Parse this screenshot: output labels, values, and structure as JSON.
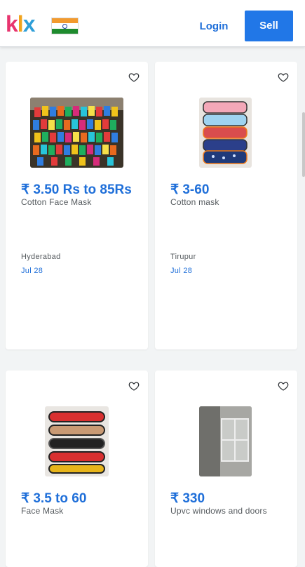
{
  "header": {
    "logo": {
      "k": "k",
      "l": "l",
      "x": "x"
    },
    "login_label": "Login",
    "sell_label": "Sell",
    "flag_icon": "india-flag-icon",
    "accent_color": "#2177e7"
  },
  "listings": [
    {
      "price": "₹ 3.50 Rs to 85Rs",
      "title": "Cotton Face Mask",
      "location": "Hyderabad",
      "date": "Jul 28",
      "image": "colorful-masks-pile-photo"
    },
    {
      "price": "₹ 3-60",
      "title": "Cotton mask",
      "location": "Tirupur",
      "date": "Jul 28",
      "image": "stacked-printed-masks-photo"
    },
    {
      "price": "₹ 3.5 to 60",
      "title": "Face Mask",
      "location": "",
      "date": "",
      "image": "fabric-masks-row-photo"
    },
    {
      "price": "₹ 330",
      "title": "Upvc windows and doors",
      "location": "",
      "date": "",
      "image": "upvc-window-photo"
    }
  ]
}
